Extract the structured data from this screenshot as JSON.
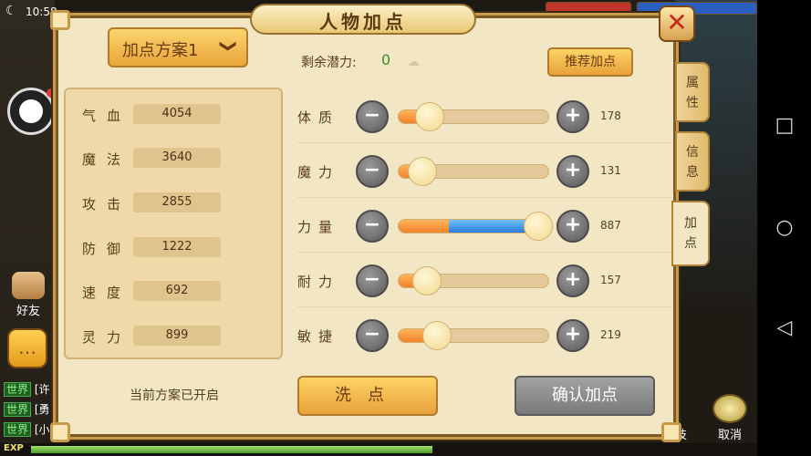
{
  "status_bar": {
    "time": "10:58",
    "moon_icon": "moon-icon"
  },
  "panel": {
    "title": "人物加点",
    "close_symbol": "✕",
    "plan_selector": {
      "label": "加点方案1",
      "chevron": "❯"
    },
    "remaining_potential": {
      "label": "剩余潜力:",
      "value": "0"
    },
    "recommend_label": "推荐加点",
    "stats": [
      {
        "label": "气血",
        "value": "4054"
      },
      {
        "label": "魔法",
        "value": "3640"
      },
      {
        "label": "攻击",
        "value": "2855"
      },
      {
        "label": "防御",
        "value": "1222"
      },
      {
        "label": "速度",
        "value": "692"
      },
      {
        "label": "灵力",
        "value": "899"
      }
    ],
    "plan_status": "当前方案已开启",
    "attributes": [
      {
        "label": "体质",
        "value": "178",
        "fill": 0.21
      },
      {
        "label": "魔力",
        "value": "131",
        "fill": 0.16
      },
      {
        "label": "力量",
        "value": "887",
        "fill": 0.93,
        "highlighted": true
      },
      {
        "label": "耐力",
        "value": "157",
        "fill": 0.19
      },
      {
        "label": "敏捷",
        "value": "219",
        "fill": 0.26
      }
    ],
    "minus_symbol": "−",
    "plus_symbol": "+",
    "wash_label": "洗点",
    "confirm_label": "确认加点",
    "side_tabs": [
      {
        "chars": [
          "属",
          "性"
        ],
        "active": false
      },
      {
        "chars": [
          "信",
          "息"
        ],
        "active": false
      },
      {
        "chars": [
          "加",
          "点"
        ],
        "active": true
      }
    ]
  },
  "left_hud": {
    "friend_label": "好友",
    "chat_channel": "世界",
    "chat_lines": [
      "[许",
      "[勇",
      "[小"
    ]
  },
  "bottom_hud": {
    "exp_label": "EXP",
    "exp_fill": 0.55,
    "cancel_label": "取消",
    "skill_partial": "技"
  },
  "colors": {
    "panel_bg": "#f3e6c4",
    "accent_orange": "#f2822a",
    "accent_blue": "#2a7ad6",
    "button_gold": "#fcd467",
    "button_gray": "#8a8a8a",
    "potential_green": "#3a8e2a",
    "close_red": "#c62b1a"
  }
}
